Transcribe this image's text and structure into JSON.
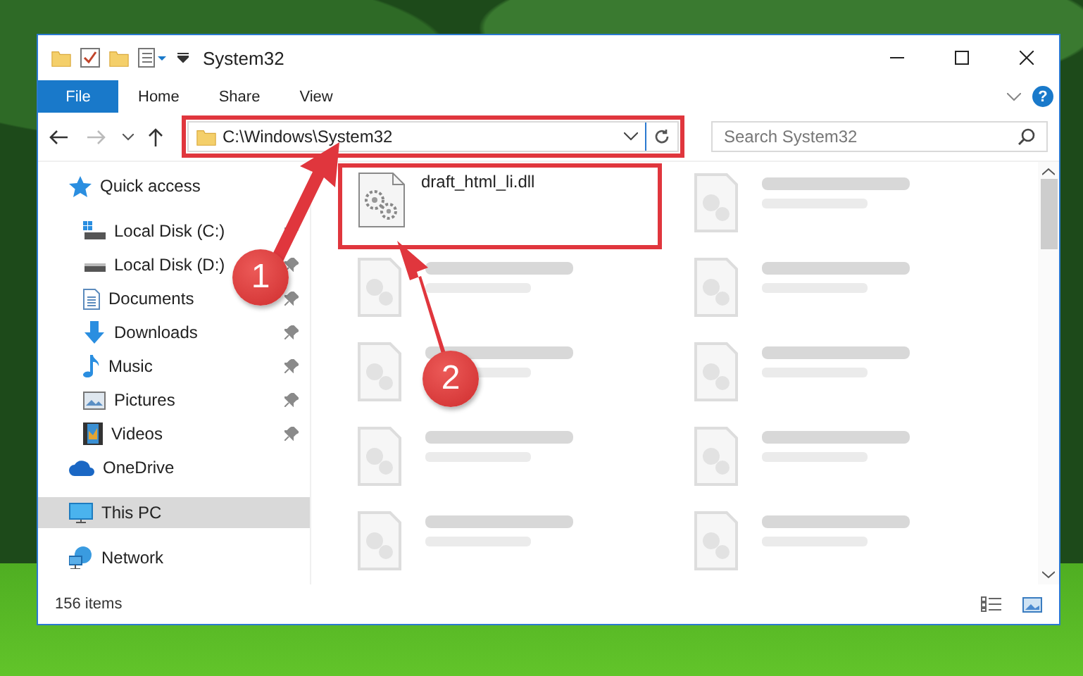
{
  "window": {
    "title": "System32"
  },
  "ribbon": {
    "tabs": [
      {
        "label": "File",
        "kind": "menu"
      },
      {
        "label": "Home",
        "kind": "tab"
      },
      {
        "label": "Share",
        "kind": "tab"
      },
      {
        "label": "View",
        "kind": "tab"
      }
    ],
    "help": "?"
  },
  "address": {
    "path": "C:\\Windows\\System32",
    "highlighted": true
  },
  "search": {
    "placeholder": "Search System32"
  },
  "sidebar": {
    "items": [
      {
        "label": "Quick access",
        "selected": false,
        "children": [
          {
            "label": "Local Disk (C:)",
            "pinned": true
          },
          {
            "label": "Local Disk (D:)",
            "pinned": true
          },
          {
            "label": "Documents",
            "pinned": true
          },
          {
            "label": "Downloads",
            "pinned": true
          },
          {
            "label": "Music",
            "pinned": true
          },
          {
            "label": "Pictures",
            "pinned": true
          },
          {
            "label": "Videos",
            "pinned": true
          }
        ]
      },
      {
        "label": "OneDrive",
        "selected": false
      },
      {
        "label": "This PC",
        "selected": true
      },
      {
        "label": "Network",
        "selected": false
      }
    ]
  },
  "files": [
    {
      "kind": "file",
      "name": "draft_html_li.dll",
      "highlighted": true
    },
    {
      "kind": "blurred"
    },
    {
      "kind": "blurred"
    },
    {
      "kind": "blurred"
    },
    {
      "kind": "blurred"
    },
    {
      "kind": "blurred"
    },
    {
      "kind": "blurred"
    },
    {
      "kind": "blurred"
    },
    {
      "kind": "blurred"
    },
    {
      "kind": "blurred"
    }
  ],
  "status_bar": {
    "count": "156 items"
  },
  "annotations": [
    {
      "number": "1"
    },
    {
      "number": "2"
    }
  ]
}
